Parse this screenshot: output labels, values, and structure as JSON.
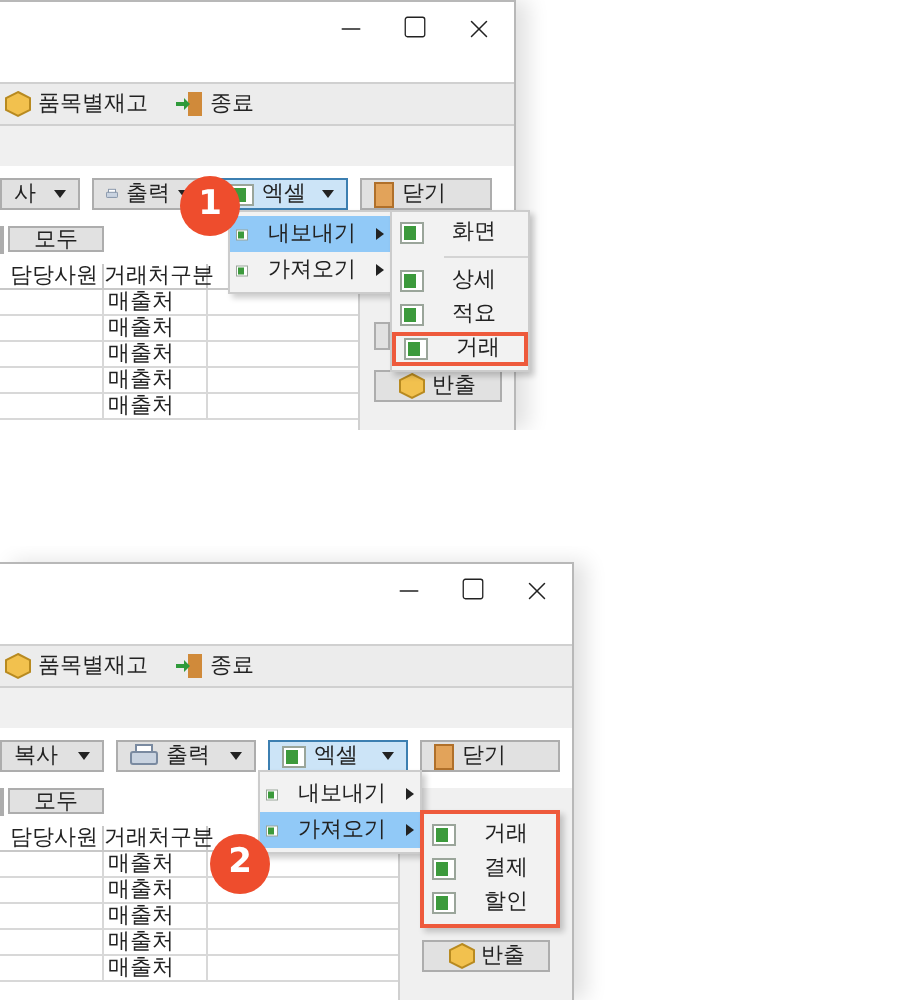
{
  "panels": [
    {
      "badge": "1",
      "toolbar": [
        {
          "label": "품목별재고",
          "kind": "box"
        },
        {
          "label": "종료",
          "kind": "exit"
        }
      ],
      "buttons": [
        {
          "label": "사",
          "kind": "dropdown",
          "selected": false
        },
        {
          "label": "출력",
          "kind": "print",
          "selected": false
        },
        {
          "label": "엑셀",
          "kind": "excel",
          "selected": true
        },
        {
          "label": "닫기",
          "kind": "close",
          "selected": false
        }
      ],
      "filter_button": "모두",
      "columns": [
        "담당사원",
        "거래처구분"
      ],
      "rows": [
        "매출처",
        "매출처",
        "매출처",
        "매출처",
        "매출처"
      ],
      "side_buttons": [
        {
          "label": "반출"
        }
      ],
      "menu": {
        "items": [
          {
            "label": "내보내기",
            "selected": true
          },
          {
            "label": "가져오기",
            "selected": false
          }
        ],
        "submenu": {
          "outlined": false,
          "items": [
            {
              "label": "화면",
              "kind": "item",
              "outlined": false
            },
            {
              "kind": "separator"
            },
            {
              "label": "상세",
              "kind": "item",
              "outlined": false
            },
            {
              "label": "적요",
              "kind": "item",
              "outlined": false
            },
            {
              "label": "거래",
              "kind": "item",
              "outlined": true
            }
          ]
        }
      }
    },
    {
      "badge": "2",
      "toolbar": [
        {
          "label": "품목별재고",
          "kind": "box"
        },
        {
          "label": "종료",
          "kind": "exit"
        }
      ],
      "buttons": [
        {
          "label": "복사",
          "kind": "dropdown",
          "selected": false
        },
        {
          "label": "출력",
          "kind": "print",
          "selected": false
        },
        {
          "label": "엑셀",
          "kind": "excel",
          "selected": true
        },
        {
          "label": "닫기",
          "kind": "close",
          "selected": false
        }
      ],
      "filter_button": "모두",
      "columns": [
        "담당사원",
        "거래처구분"
      ],
      "rows": [
        "매출처",
        "매출처",
        "매출처",
        "매출처",
        "매출처"
      ],
      "side_buttons": [
        {
          "label": "반출"
        }
      ],
      "menu": {
        "items": [
          {
            "label": "내보내기",
            "selected": false
          },
          {
            "label": "가져오기",
            "selected": true
          }
        ],
        "submenu": {
          "outlined": true,
          "items": [
            {
              "label": "거래",
              "kind": "item",
              "outlined": false
            },
            {
              "label": "결제",
              "kind": "item",
              "outlined": false
            },
            {
              "label": "할인",
              "kind": "item",
              "outlined": false
            }
          ]
        }
      }
    }
  ]
}
